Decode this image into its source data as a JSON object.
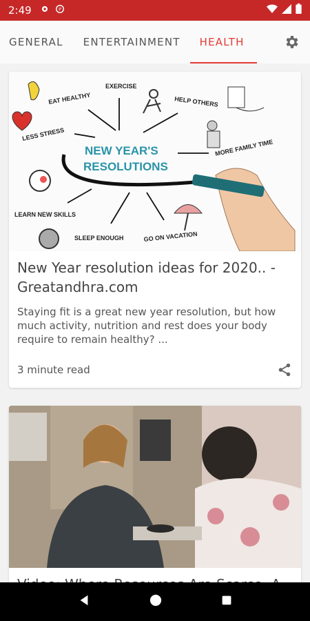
{
  "status": {
    "time": "2:49"
  },
  "tabs": [
    {
      "label": "GENERAL"
    },
    {
      "label": "ENTERTAINMENT"
    },
    {
      "label": "HEALTH"
    }
  ],
  "articles": [
    {
      "title": "New Year resolution ideas for 2020.. - Greatandhra.com",
      "description": "Staying fit is a great new year resolution, but how much activity, nutrition and rest does your body require to remain healthy? ...",
      "read_time": "3 minute read",
      "image_text": {
        "headline1": "NEW YEAR'S",
        "headline2": "RESOLUTIONS",
        "labels": [
          "EAT HEALTHY",
          "EXERCISE",
          "HELP OTHERS",
          "LESS STRESS",
          "MORE FAMILY TIME",
          "LEARN NEW SKILLS",
          "SLEEP ENOUGH",
          "GO ON VACATION"
        ]
      }
    },
    {
      "title": "Video: Where Resources Are Scarce, A"
    }
  ],
  "colors": {
    "status_bar": "#c62828",
    "accent": "#e53935"
  }
}
